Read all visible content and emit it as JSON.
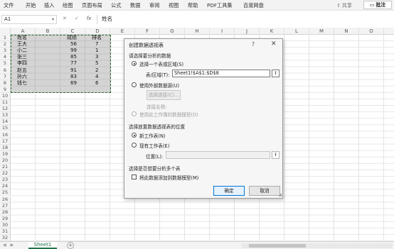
{
  "menu": {
    "items": [
      "文件",
      "开始",
      "插入",
      "绘图",
      "页面布局",
      "公式",
      "数据",
      "审阅",
      "视图",
      "帮助",
      "PDF工具集",
      "百度网盘"
    ],
    "share_label": "共享",
    "comment_label": "批注"
  },
  "formula_bar": {
    "name_box": "A1",
    "cancel_icon": "✕",
    "confirm_icon": "✓",
    "fx_label": "fx",
    "content": "姓名"
  },
  "grid": {
    "columns": [
      "A",
      "B",
      "C",
      "D",
      "E",
      "F",
      "G",
      "H",
      "I",
      "J",
      "K",
      "L",
      "M",
      "N",
      "O"
    ],
    "rows": [
      "1",
      "2",
      "3",
      "4",
      "5",
      "6",
      "7",
      "8",
      "9",
      "10",
      "11",
      "12",
      "13",
      "14",
      "15",
      "16",
      "17",
      "18",
      "19",
      "20",
      "21",
      "22",
      "23",
      "24",
      "25",
      "26",
      "27",
      "28",
      "29",
      "30",
      "31",
      "32"
    ],
    "header": {
      "name": "姓名",
      "score": "成绩",
      "rank": "排名"
    },
    "records": [
      {
        "name": "王大",
        "score": "56",
        "rank": "7"
      },
      {
        "name": "小二",
        "score": "99",
        "rank": "1"
      },
      {
        "name": "张三",
        "score": "85",
        "rank": "3"
      },
      {
        "name": "李四",
        "score": "77",
        "rank": "5"
      },
      {
        "name": "赵五",
        "score": "91",
        "rank": "2"
      },
      {
        "name": "孙六",
        "score": "83",
        "rank": "4"
      },
      {
        "name": "钱七",
        "score": "69",
        "rank": "6"
      }
    ]
  },
  "sheets": {
    "active": "Sheet1",
    "add_label": "+"
  },
  "dialog": {
    "title": "创建数据透视表",
    "help": "?",
    "close": "✕",
    "section1": "请选择要分析的数据",
    "opt_table": "选择一个表或区域(S)",
    "range_label": "表/区域(T):",
    "range_value": "Sheet1!$A$1:$D$8",
    "opt_external": "使用外部数据源(U)",
    "choose_conn": "选择连接(C)...",
    "conn_name": "连接名称:",
    "opt_model": "使用此工作簿的数据模型(D)",
    "section2": "选择放置数据透视表的位置",
    "opt_new_sheet": "新工作表(N)",
    "opt_existing": "现有工作表(E)",
    "location_label": "位置(L):",
    "location_value": "",
    "section3": "选择是否想要分析多个表",
    "add_to_model": "将此数据添加到数据模型(M)",
    "ok": "确定",
    "cancel": "取消"
  }
}
